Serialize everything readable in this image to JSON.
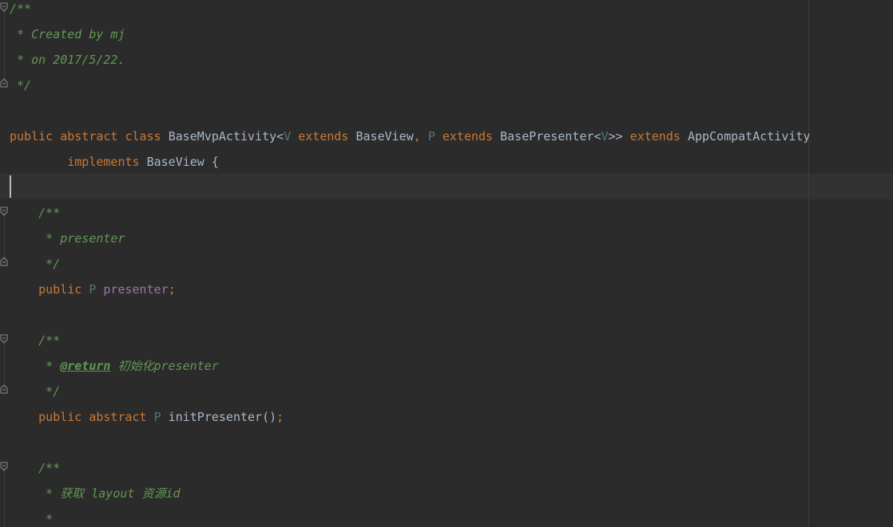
{
  "colors": {
    "background": "#2b2b2b",
    "keyword": "#cc7832",
    "comment": "#629755",
    "type_param": "#507874",
    "field": "#9876aa",
    "text": "#a9b7c6"
  },
  "code": {
    "l1": {
      "c0": "/**"
    },
    "l2": {
      "c0": " * Created by mj"
    },
    "l3": {
      "c0": " * on 2017/5/22."
    },
    "l4": {
      "c0": " */"
    },
    "l6": {
      "k0": "public abstract class ",
      "t0": "BaseMvpActivity<",
      "tp0": "V",
      "k1": " extends ",
      "t1": "BaseView",
      "k2": ", ",
      "tp1": "P",
      "k3": " extends ",
      "t2": "BasePresenter<",
      "tp2": "V",
      "t3": ">> ",
      "k4": "extends ",
      "t4": "AppCompatActivity"
    },
    "l7": {
      "k0": "        implements ",
      "t0": "BaseView {"
    },
    "l9": {
      "c0": "    /**"
    },
    "l10": {
      "c0": "     * presenter"
    },
    "l11": {
      "c0": "     */"
    },
    "l12": {
      "k0": "    public ",
      "tp0": "P ",
      "f0": "presenter",
      "k1": ";"
    },
    "l14": {
      "c0": "    /**"
    },
    "l15": {
      "c0": "     * ",
      "tag": "@return",
      "c1": " 初始化presenter"
    },
    "l16": {
      "c0": "     */"
    },
    "l17": {
      "k0": "    public abstract ",
      "tp0": "P ",
      "t0": "initPresenter",
      "p0": "()",
      "k1": ";"
    },
    "l19": {
      "c0": "    /**"
    },
    "l20": {
      "c0": "     * 获取 layout 资源id"
    },
    "l21": {
      "c0": "     *"
    }
  }
}
